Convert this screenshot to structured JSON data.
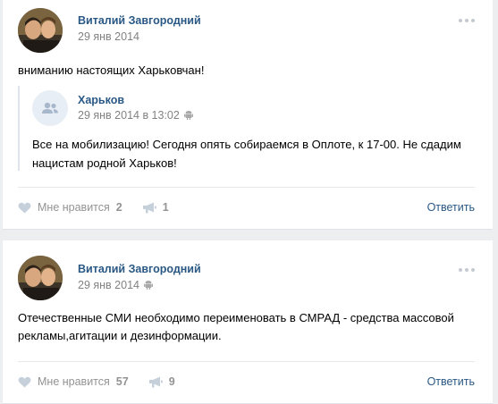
{
  "posts": [
    {
      "author": "Виталий Завгородний",
      "date": "29 янв 2014",
      "text": "вниманию настоящих Харьковчан!",
      "repost": {
        "group": "Харьков",
        "date": "29 янв 2014 в 13:02",
        "text_line1": "Все на мобилизацию! Сегодня опять собираемся в Оплоте, к 17-00. Не сдадим",
        "text_line2": "нацистам родной Харьков!"
      },
      "likes_label": "Мне нравится",
      "likes_count": "2",
      "shares_count": "1",
      "reply_label": "Ответить"
    },
    {
      "author": "Виталий Завгородний",
      "date": "29 янв 2014",
      "text_line1": "Отечественные СМИ необходимо переименовать в СМРАД - средства массовой",
      "text_line2": "рекламы,агитации и дезинформации.",
      "likes_label": "Мне нравится",
      "likes_count": "57",
      "shares_count": "9",
      "reply_label": "Ответить"
    }
  ],
  "icons": {
    "like": "heart-icon",
    "share": "megaphone-icon",
    "more": "more-dots-icon",
    "platform": "android-icon",
    "group_placeholder": "community-icon"
  },
  "colors": {
    "link": "#2a5885",
    "meta": "#828282",
    "action": "#939393",
    "background": "#edeef0"
  }
}
